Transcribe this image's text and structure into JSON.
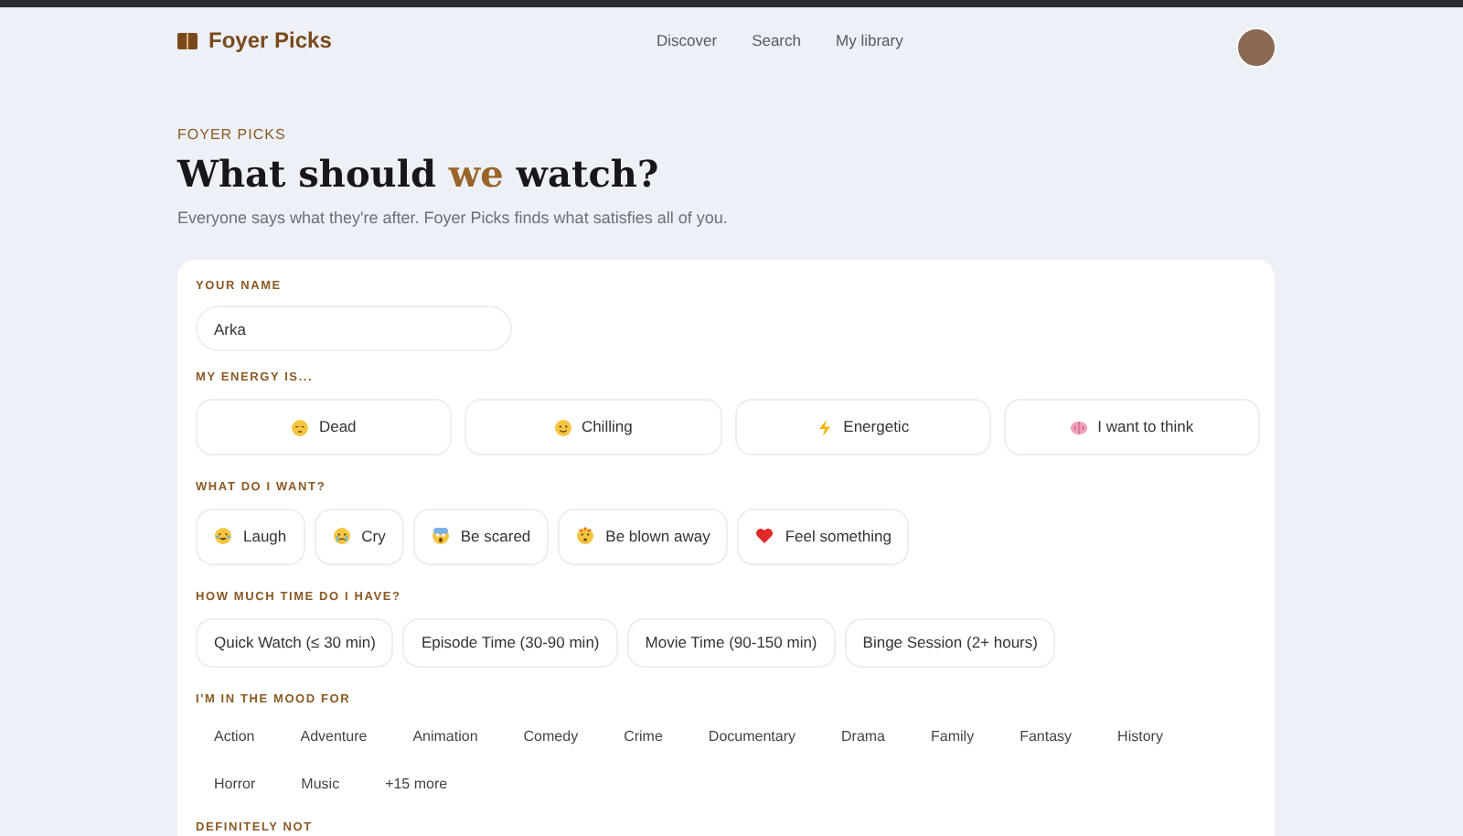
{
  "nav": {
    "brand": "Foyer Picks",
    "links": [
      "Discover",
      "Search",
      "My library"
    ]
  },
  "hero": {
    "eyebrow": "FOYER PICKS",
    "title": "What should **we** watch?",
    "subtitle": "Everyone says what they're after. Foyer Picks finds what satisfies all of you."
  },
  "form": {
    "name": {
      "label": "YOUR NAME",
      "value": "Arka"
    },
    "energy": {
      "label": "MY ENERGY IS...",
      "options": [
        {
          "label": "Dead",
          "selected": false
        },
        {
          "label": "Chilling",
          "selected": false
        },
        {
          "label": "Energetic",
          "selected": false
        },
        {
          "label": "I want to think",
          "selected": false
        }
      ]
    },
    "want": {
      "label": "WHAT DO I WANT?",
      "options": [
        {
          "label": "Laugh",
          "selected": false
        },
        {
          "label": "Cry",
          "selected": false
        },
        {
          "label": "Be scared",
          "selected": false
        },
        {
          "label": "Be blown away",
          "selected": false
        },
        {
          "label": "Feel something",
          "selected": false
        }
      ]
    },
    "time": {
      "label": "HOW MUCH TIME DO I HAVE?",
      "options": [
        {
          "label": "Quick Watch (≤ 30 min)",
          "selected": false
        },
        {
          "label": "Episode Time (30-90 min)",
          "selected": false
        },
        {
          "label": "Movie Time (90-150 min)",
          "selected": false
        },
        {
          "label": "Binge Session (2+ hours)",
          "selected": false
        }
      ]
    },
    "mood": {
      "label": "I'M IN THE MOOD FOR",
      "genres": [
        {
          "label": "Action",
          "selected": false
        },
        {
          "label": "Adventure",
          "selected": false
        },
        {
          "label": "Animation",
          "selected": false
        },
        {
          "label": "Comedy",
          "selected": false
        },
        {
          "label": "Crime",
          "selected": false
        },
        {
          "label": "Documentary",
          "selected": false
        },
        {
          "label": "Drama",
          "selected": false
        },
        {
          "label": "Family",
          "selected": false
        },
        {
          "label": "Fantasy",
          "selected": false
        },
        {
          "label": "History",
          "selected": false
        },
        {
          "label": "Horror",
          "selected": false
        },
        {
          "label": "Music",
          "selected": false
        }
      ],
      "more": "+15 more"
    },
    "definitely_not": {
      "label": "DEFINITELY NOT"
    }
  }
}
